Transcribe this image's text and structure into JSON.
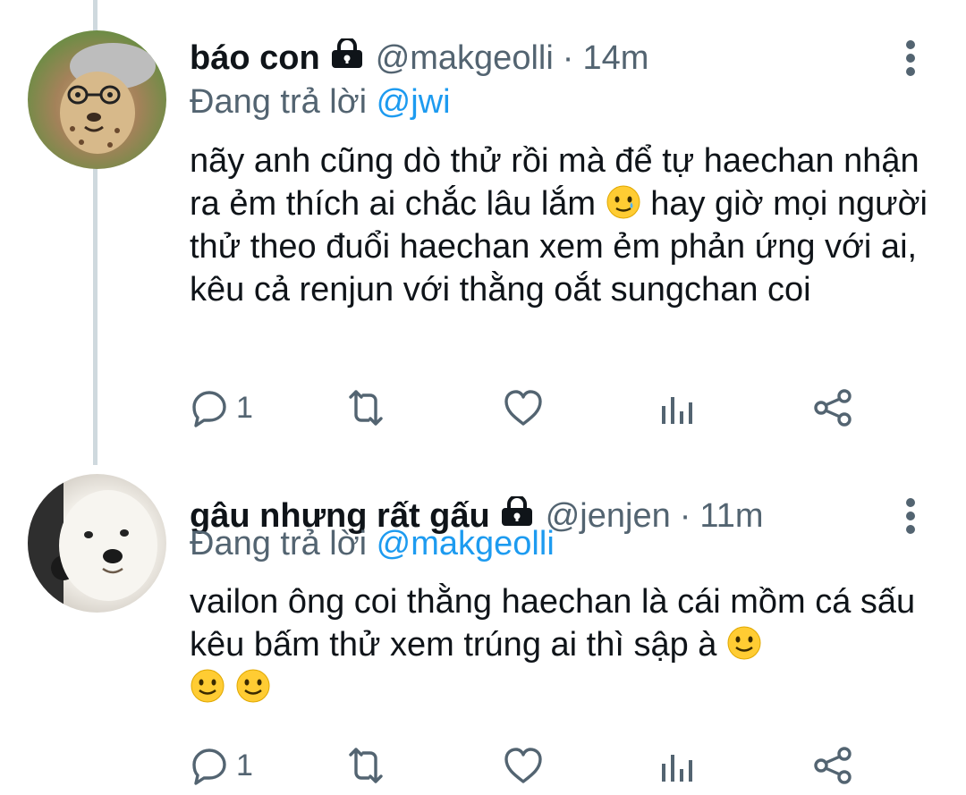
{
  "colors": {
    "text": "#0f1419",
    "secondary": "#536471",
    "link": "#1d9bf0",
    "thread_line": "#cfd9de"
  },
  "tweets": [
    {
      "display_name": "báo con",
      "handle": "@makgeolli",
      "time": "14m",
      "separator": "·",
      "reply_prefix": "Đang trả lời",
      "reply_to": "@jwi",
      "text_parts": [
        "nãy anh cũng dò thử rồi mà để tự haechan nhận ra ẻm thích ai chắc lâu lắm",
        "hay giờ mọi người thử theo đuổi haechan xem ẻm phản ứng với ai, kêu cả renjun với thằng oắt sungchan coi"
      ],
      "emoji": "smiling-tear-emoji",
      "reply_count": "1",
      "avatar": "cheetah-cub-avatar"
    },
    {
      "display_name": "gâu nhưng rất gấu",
      "handle": "@jenjen",
      "time": "11m",
      "separator": "·",
      "reply_prefix": "Đang trả lời",
      "reply_to": "@makgeolli",
      "text_parts": [
        "vailon ông coi thằng haechan là cái mồm cá sấu kêu bấm thử xem trúng ai thì sập à"
      ],
      "emoji": "slightly-smiling-emoji",
      "reply_count": "1",
      "avatar": "white-dog-avatar"
    }
  ],
  "icons": [
    "lock-icon",
    "more-icon",
    "reply-icon",
    "retweet-icon",
    "like-icon",
    "analytics-icon",
    "share-icon"
  ]
}
